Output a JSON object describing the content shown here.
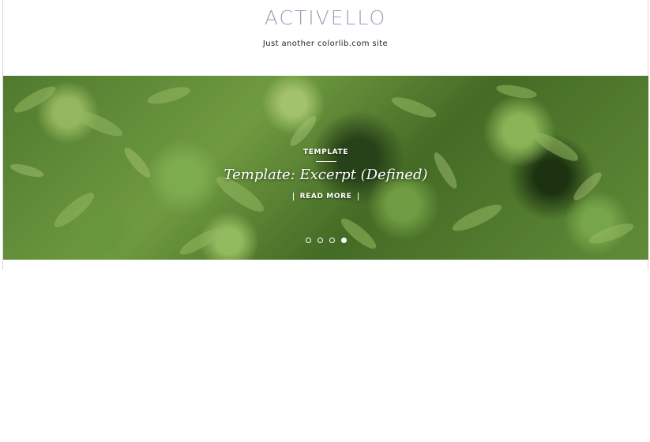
{
  "site": {
    "title": "ACTIVELLO",
    "tagline": "Just another colorlib.com site"
  },
  "slider": {
    "category": "TEMPLATE",
    "title": "Template: Excerpt (Defined)",
    "read_more": "READ MORE",
    "slide_count": 4,
    "active_slide": 4
  },
  "colors": {
    "logo": "#a29ab5",
    "tagline": "#222222",
    "overlay_text": "#ffffff"
  }
}
